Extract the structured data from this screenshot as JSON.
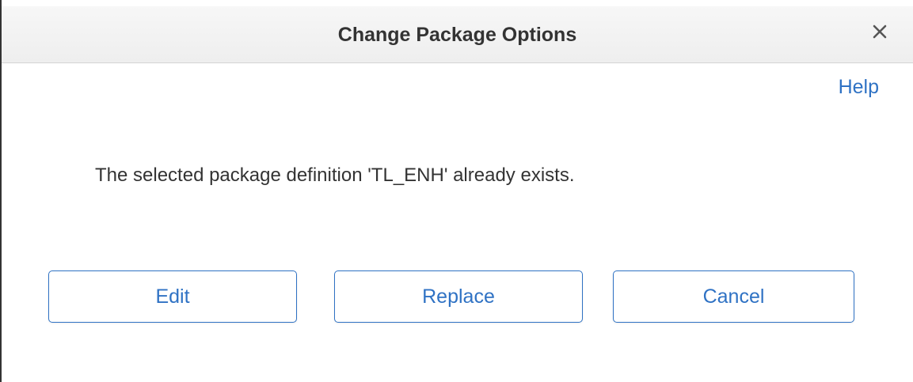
{
  "dialog": {
    "title": "Change Package Options",
    "close_icon": "close-icon",
    "help_label": "Help",
    "message": "The selected package definition 'TL_ENH' already exists.",
    "buttons": {
      "edit": "Edit",
      "replace": "Replace",
      "cancel": "Cancel"
    }
  },
  "colors": {
    "accent": "#2f72c4",
    "title_text": "#333333",
    "titlebar_bg": "#efefef"
  }
}
